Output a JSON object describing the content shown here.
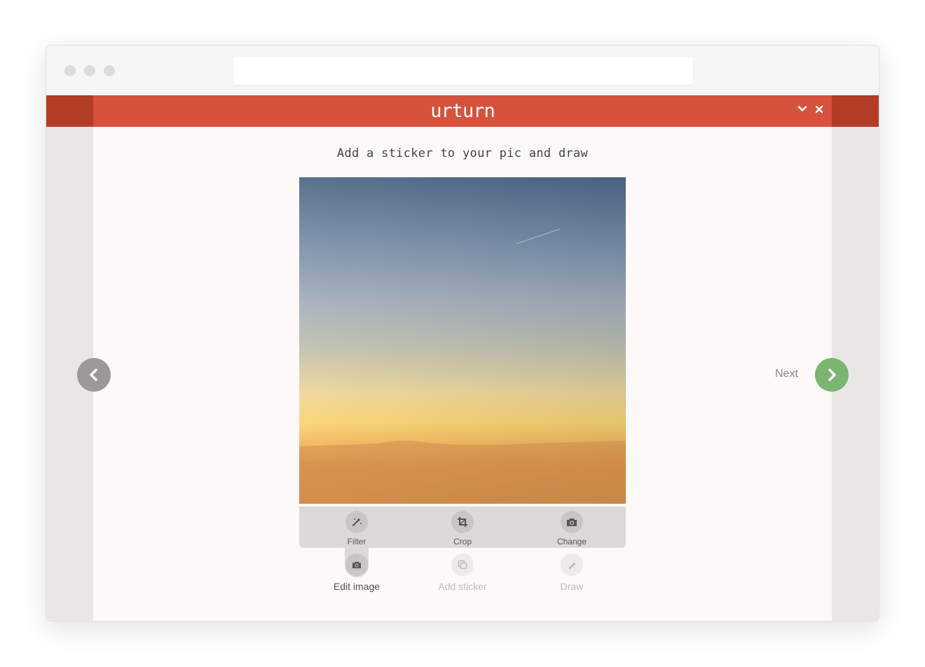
{
  "app": {
    "logo": "urturn"
  },
  "header": {
    "minimize_icon": "chevron-down-icon",
    "close_icon": "close-icon"
  },
  "main": {
    "subtitle": "Add a sticker to your pic and draw"
  },
  "tools": [
    {
      "label": "Filter",
      "icon": "magic-wand-icon"
    },
    {
      "label": "Crop",
      "icon": "crop-icon"
    },
    {
      "label": "Change",
      "icon": "camera-icon"
    }
  ],
  "steps": [
    {
      "label": "Edit image",
      "icon": "camera-icon",
      "active": true
    },
    {
      "label": "Add sticker",
      "icon": "sticker-icon",
      "active": false
    },
    {
      "label": "Draw",
      "icon": "pencil-icon",
      "active": false
    }
  ],
  "nav": {
    "next_label": "Next",
    "prev_icon": "chevron-left-icon",
    "next_icon": "chevron-right-icon"
  },
  "colors": {
    "header": "#d5523d",
    "header_dark": "#b33c26",
    "next": "#7cb471",
    "prev": "#9b9898"
  }
}
